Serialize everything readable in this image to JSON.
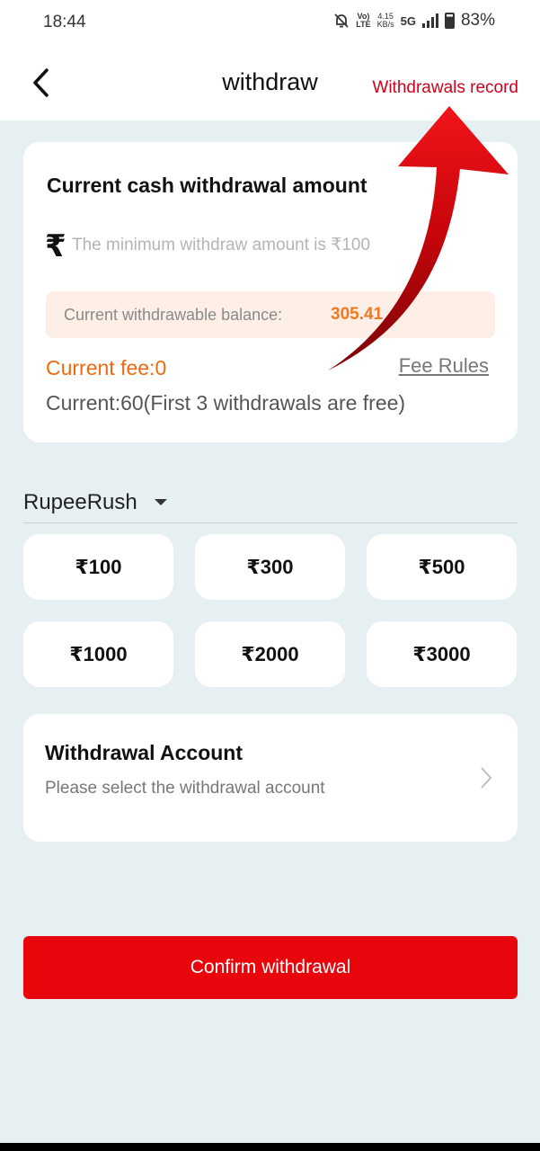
{
  "status_bar": {
    "time": "18:44",
    "net_speed_top": "4.15",
    "net_speed_bottom": "KB/s",
    "volte_top": "Vo)",
    "volte_bottom": "LTE",
    "network": "5G",
    "battery_percent": "83%",
    "battery_level": 0.83
  },
  "header": {
    "title": "withdraw",
    "records_link": "Withdrawals record"
  },
  "amount_card": {
    "title": "Current cash withdrawal amount",
    "currency_symbol": "₹",
    "input_placeholder": "The minimum withdraw amount is ₹100",
    "balance_label": "Current withdrawable balance:",
    "balance_value": "305.41",
    "fee_text": "Current fee:0",
    "fee_rules_label": "Fee Rules",
    "current_text": "Current:60(First 3 withdrawals are free)"
  },
  "channel": {
    "name": "RupeeRush"
  },
  "amount_options": [
    "₹100",
    "₹300",
    "₹500",
    "₹1000",
    "₹2000",
    "₹3000"
  ],
  "account": {
    "title": "Withdrawal Account",
    "subtitle": "Please select the withdrawal account"
  },
  "confirm_button": "Confirm withdrawal",
  "colors": {
    "accent_red": "#e8050b",
    "link_red": "#d0021b",
    "fee_orange": "#ee6a11",
    "balance_bg": "#fdeee6",
    "page_bg": "#e6eff2"
  },
  "icons": {
    "back": "chevron-left-icon",
    "dropdown": "caret-down-icon",
    "account_arrow": "chevron-right-icon",
    "annotation": "red-curved-arrow-icon"
  }
}
